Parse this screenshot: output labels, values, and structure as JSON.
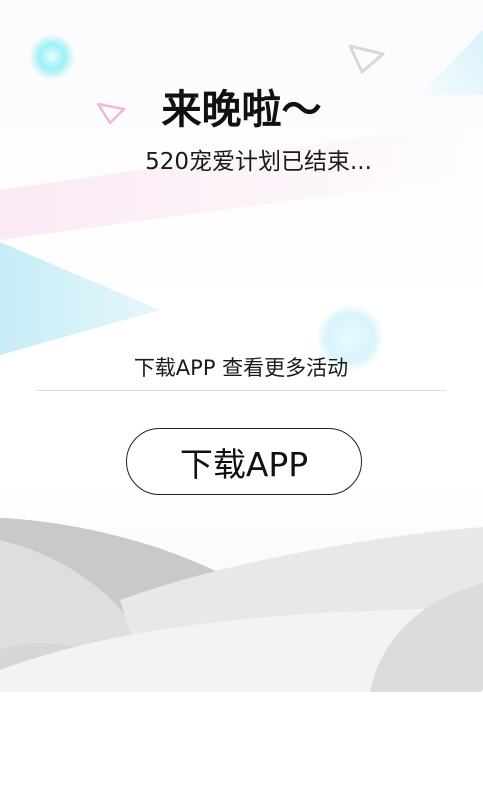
{
  "promo": {
    "title": "来晚啦～",
    "subtitle": "520宠爱计划已结束...",
    "hint": "下载APP  查看更多活动",
    "download_button": "下载APP"
  },
  "colors": {
    "accent_pink": "#f5a7c8",
    "accent_cyan": "#7fe8f4",
    "hill_gray": "#c9c9c9"
  }
}
